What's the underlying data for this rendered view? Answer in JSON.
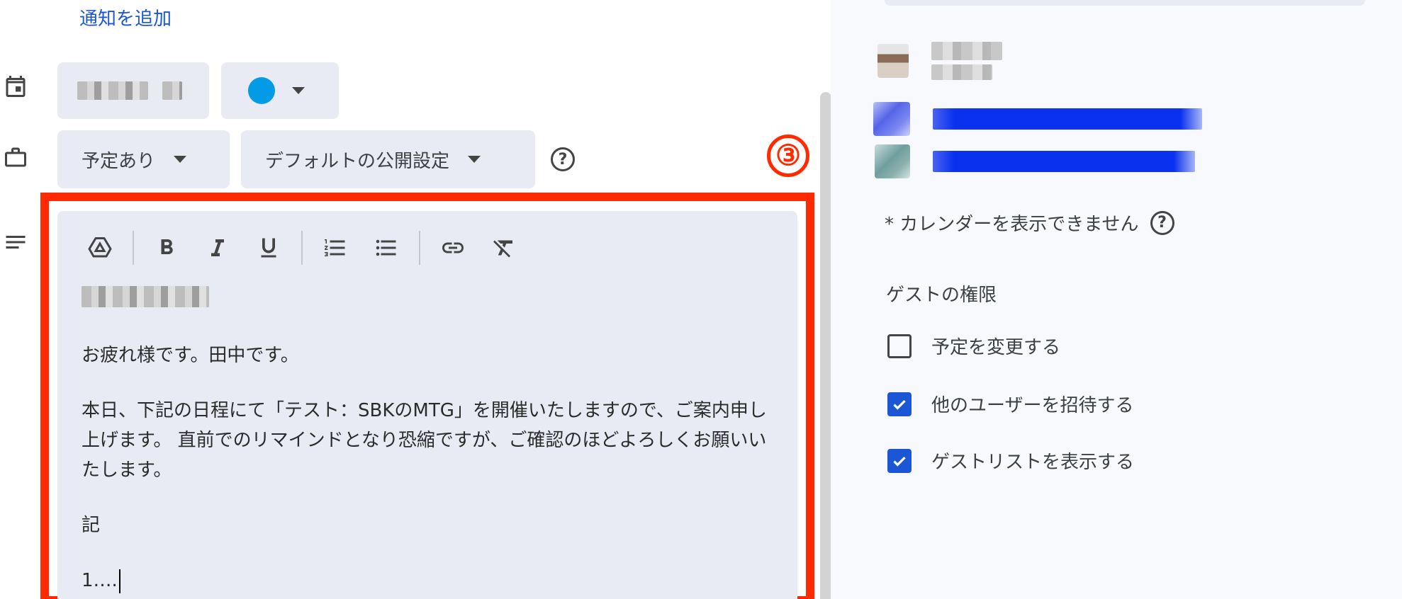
{
  "notifications": {
    "add_label": "通知を追加"
  },
  "calendar_row": {
    "color_accent": "#039be5"
  },
  "availability": {
    "status_label": "予定あり",
    "visibility_label": "デフォルトの公開設定",
    "help": "?"
  },
  "annotation": {
    "marker": "③",
    "color": "#ff2a00"
  },
  "editor": {
    "toolbar": [
      "drive-icon",
      "bold-icon",
      "italic-icon",
      "underline-icon",
      "numbered-list-icon",
      "bulleted-list-icon",
      "link-icon",
      "clear-format-icon"
    ],
    "paragraphs": [
      "お疲れ様です。田中です。",
      "本日、下記の日程にて「テスト：SBKのMTG」を開催いたしますので、ご案内申し上げます。 直前でのリマインドとなり恐縮ですが、ご確認のほどよろしくお願いいたします。",
      "記",
      "1…."
    ]
  },
  "right_panel": {
    "calendar_note": "* カレンダーを表示できません",
    "help": "?",
    "guest_permissions": {
      "title": "ゲストの権限",
      "items": [
        {
          "label": "予定を変更する",
          "checked": false
        },
        {
          "label": "他のユーザーを招待する",
          "checked": true
        },
        {
          "label": "ゲストリストを表示する",
          "checked": true
        }
      ]
    }
  }
}
